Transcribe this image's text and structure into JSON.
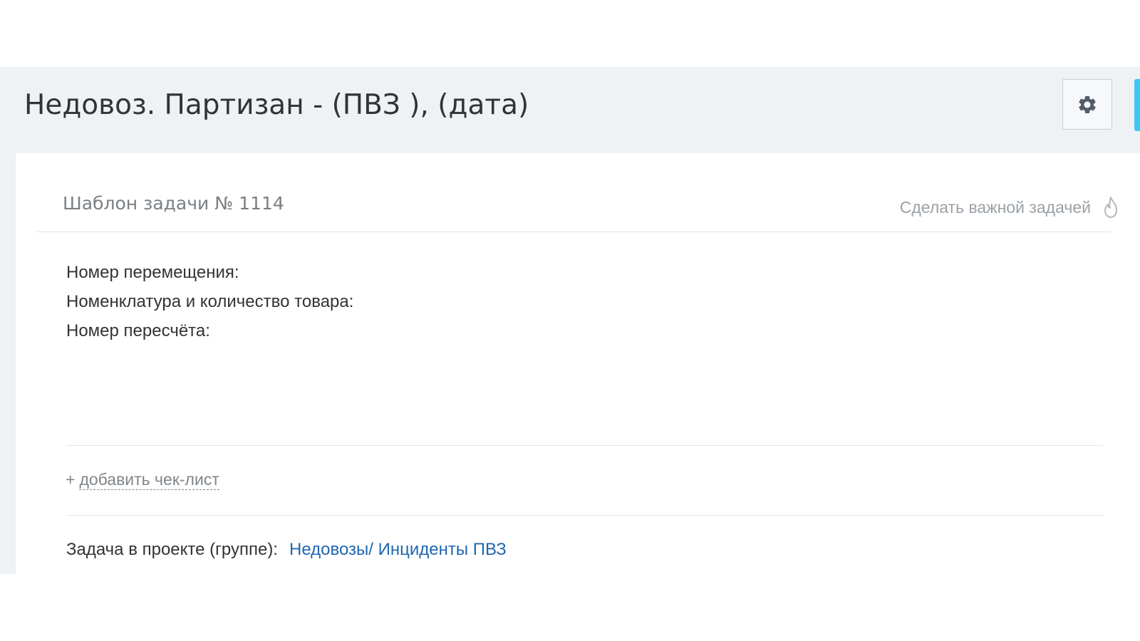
{
  "header": {
    "title": "Недовоз. Партизан - (ПВЗ ), (дата)",
    "settings_icon": "gear-icon",
    "accent_color": "#3bc8f5"
  },
  "task": {
    "template_label": "Шаблон задачи № 1114",
    "make_important_label": "Сделать важной задачей",
    "important_icon": "flame-icon",
    "description_lines": [
      "Номер перемещения:",
      "Номенклатура и количество товара:",
      "Номер пересчёта:"
    ],
    "add_checklist_plus": "+",
    "add_checklist_label": "добавить чек-лист",
    "project_label": "Задача в проекте (группе):",
    "project_link": "Недовозы/ Инциденты ПВЗ",
    "link_color": "#2067b0"
  }
}
